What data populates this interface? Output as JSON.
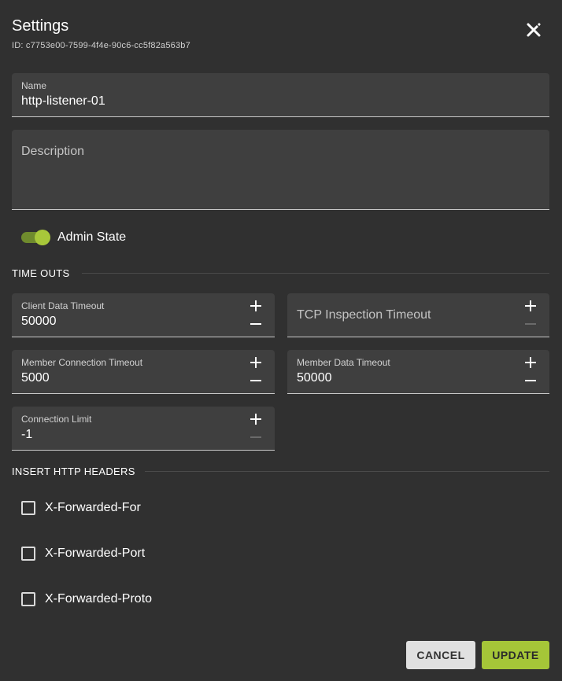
{
  "dialog": {
    "title": "Settings",
    "id_text": "ID: c7753e00-7599-4f4e-90c6-cc5f82a563b7",
    "close_icon": "close-icon"
  },
  "form": {
    "name": {
      "label": "Name",
      "value": "http-listener-01"
    },
    "description": {
      "placeholder": "Description",
      "value": ""
    },
    "admin_state": {
      "label": "Admin State",
      "enabled": true
    }
  },
  "timeouts": {
    "heading": "TIME OUTS",
    "client_data_timeout": {
      "label": "Client Data Timeout",
      "value": "50000"
    },
    "tcp_inspection_timeout": {
      "placeholder": "TCP Inspection Timeout",
      "value": ""
    },
    "member_connection_timeout": {
      "label": "Member Connection Timeout",
      "value": "5000"
    },
    "member_data_timeout": {
      "label": "Member Data Timeout",
      "value": "50000"
    },
    "connection_limit": {
      "label": "Connection Limit",
      "value": "-1"
    }
  },
  "http_headers": {
    "heading": "INSERT HTTP HEADERS",
    "items": [
      {
        "label": "X-Forwarded-For",
        "checked": false
      },
      {
        "label": "X-Forwarded-Port",
        "checked": false
      },
      {
        "label": "X-Forwarded-Proto",
        "checked": false
      }
    ]
  },
  "actions": {
    "cancel_label": "CANCEL",
    "update_label": "UPDATE"
  },
  "colors": {
    "background": "#303030",
    "field_background": "#3f3f3f",
    "accent": "#a5c638",
    "toggle_track": "#6f8b2d"
  }
}
